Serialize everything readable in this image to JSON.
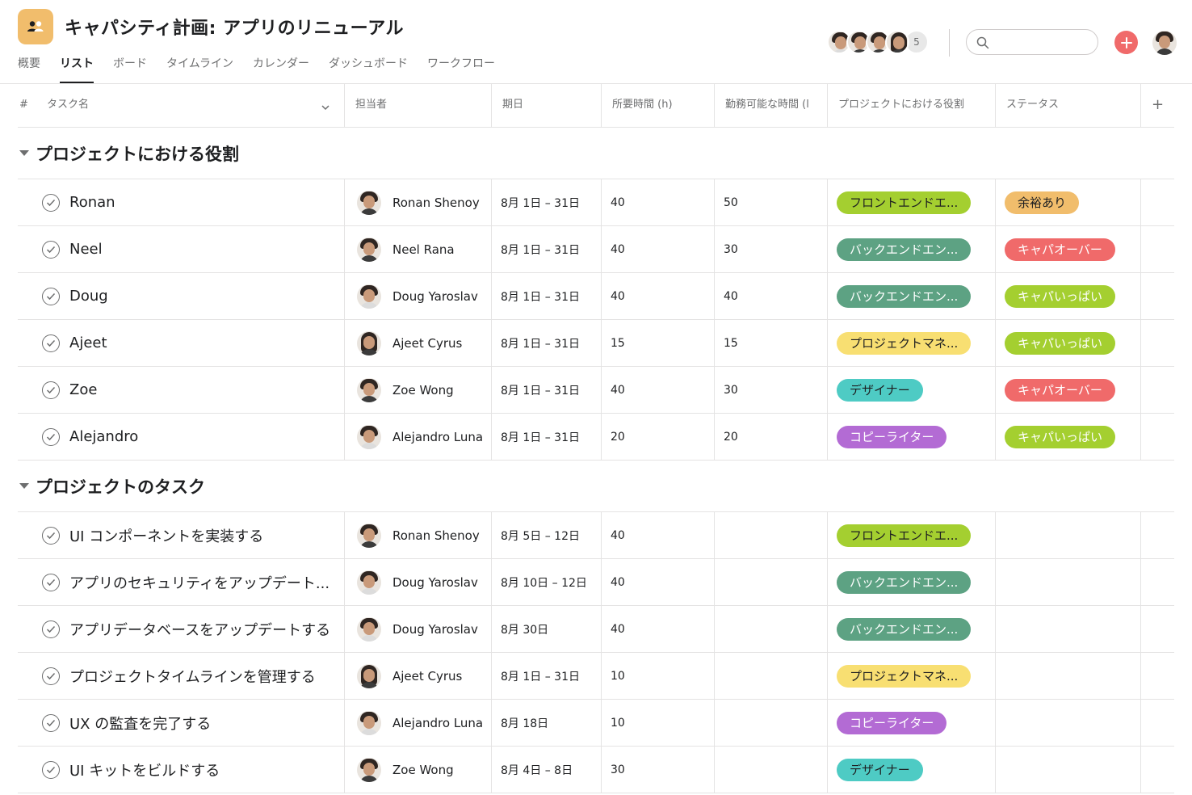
{
  "project": {
    "title": "キャパシティ計画: アプリのリニューアル",
    "icon": "people-icon",
    "icon_color": "#f1bd6c"
  },
  "tabs": [
    {
      "label": "概要",
      "active": false
    },
    {
      "label": "リスト",
      "active": true
    },
    {
      "label": "ボード",
      "active": false
    },
    {
      "label": "タイムライン",
      "active": false
    },
    {
      "label": "カレンダー",
      "active": false
    },
    {
      "label": "ダッシュボード",
      "active": false
    },
    {
      "label": "ワークフロー",
      "active": false
    }
  ],
  "members": {
    "count": "5"
  },
  "search": {
    "placeholder": ""
  },
  "columns": {
    "num": "#",
    "task": "タスク名",
    "assignee": "担当者",
    "due": "期日",
    "hours": "所要時間 (h)",
    "available": "勤務可能な時間 (l",
    "role": "プロジェクトにおける役割",
    "status": "ステータス",
    "add": "+"
  },
  "colors": {
    "frontend": "#a4cf30",
    "backend": "#5da283",
    "pm": "#f8df72",
    "designer": "#4ecbc4",
    "copywriter": "#b36bd4",
    "available": "#f1bd6c",
    "overload": "#f06a6a",
    "full": "#a4cf30"
  },
  "sections": [
    {
      "name": "プロジェクトにおける役割",
      "rows": [
        {
          "task": "Ronan",
          "assignee": "Ronan Shenoy",
          "due": "8月 1日 – 31日",
          "hours": "40",
          "available": "50",
          "role": "フロントエンドエ...",
          "role_color": "#a4cf30",
          "role_dark": true,
          "status": "余裕あり",
          "status_color": "#f1bd6c",
          "status_dark": true
        },
        {
          "task": "Neel",
          "assignee": "Neel Rana",
          "due": "8月 1日 – 31日",
          "hours": "40",
          "available": "30",
          "role": "バックエンドエン...",
          "role_color": "#5da283",
          "role_dark": false,
          "status": "キャパオーバー",
          "status_color": "#f06a6a",
          "status_dark": false
        },
        {
          "task": "Doug",
          "assignee": "Doug Yaroslav",
          "due": "8月 1日 – 31日",
          "hours": "40",
          "available": "40",
          "role": "バックエンドエン...",
          "role_color": "#5da283",
          "role_dark": false,
          "status": "キャパいっぱい",
          "status_color": "#a4cf30",
          "status_dark": false
        },
        {
          "task": "Ajeet",
          "assignee": "Ajeet Cyrus",
          "due": "8月 1日 – 31日",
          "hours": "15",
          "available": "15",
          "role": "プロジェクトマネ...",
          "role_color": "#f8df72",
          "role_dark": true,
          "status": "キャパいっぱい",
          "status_color": "#a4cf30",
          "status_dark": false
        },
        {
          "task": "Zoe",
          "assignee": "Zoe Wong",
          "due": "8月 1日 – 31日",
          "hours": "40",
          "available": "30",
          "role": "デザイナー",
          "role_color": "#4ecbc4",
          "role_dark": true,
          "status": "キャパオーバー",
          "status_color": "#f06a6a",
          "status_dark": false
        },
        {
          "task": "Alejandro",
          "assignee": "Alejandro Luna",
          "due": "8月 1日 – 31日",
          "hours": "20",
          "available": "20",
          "role": "コピーライター",
          "role_color": "#b36bd4",
          "role_dark": false,
          "status": "キャパいっぱい",
          "status_color": "#a4cf30",
          "status_dark": false
        }
      ]
    },
    {
      "name": "プロジェクトのタスク",
      "rows": [
        {
          "task": "UI コンポーネントを実装する",
          "assignee": "Ronan Shenoy",
          "due": "8月 5日 – 12日",
          "hours": "40",
          "available": "",
          "role": "フロントエンドエ...",
          "role_color": "#a4cf30",
          "role_dark": true,
          "status": "",
          "status_color": "",
          "status_dark": false
        },
        {
          "task": "アプリのセキュリティをアップデート...",
          "assignee": "Doug Yaroslav",
          "due": "8月 10日 – 12日",
          "hours": "40",
          "available": "",
          "role": "バックエンドエン...",
          "role_color": "#5da283",
          "role_dark": false,
          "status": "",
          "status_color": "",
          "status_dark": false
        },
        {
          "task": "アプリデータベースをアップデートする",
          "assignee": "Doug Yaroslav",
          "due": "8月 30日",
          "hours": "40",
          "available": "",
          "role": "バックエンドエン...",
          "role_color": "#5da283",
          "role_dark": false,
          "status": "",
          "status_color": "",
          "status_dark": false
        },
        {
          "task": "プロジェクトタイムラインを管理する",
          "assignee": "Ajeet Cyrus",
          "due": "8月 1日 – 31日",
          "hours": "10",
          "available": "",
          "role": "プロジェクトマネ...",
          "role_color": "#f8df72",
          "role_dark": true,
          "status": "",
          "status_color": "",
          "status_dark": false
        },
        {
          "task": "UX の監査を完了する",
          "assignee": "Alejandro Luna",
          "due": "8月 18日",
          "hours": "10",
          "available": "",
          "role": "コピーライター",
          "role_color": "#b36bd4",
          "role_dark": false,
          "status": "",
          "status_color": "",
          "status_dark": false
        },
        {
          "task": "UI キットをビルドする",
          "assignee": "Zoe Wong",
          "due": "8月 4日 – 8日",
          "hours": "30",
          "available": "",
          "role": "デザイナー",
          "role_color": "#4ecbc4",
          "role_dark": true,
          "status": "",
          "status_color": "",
          "status_dark": false
        }
      ]
    }
  ]
}
